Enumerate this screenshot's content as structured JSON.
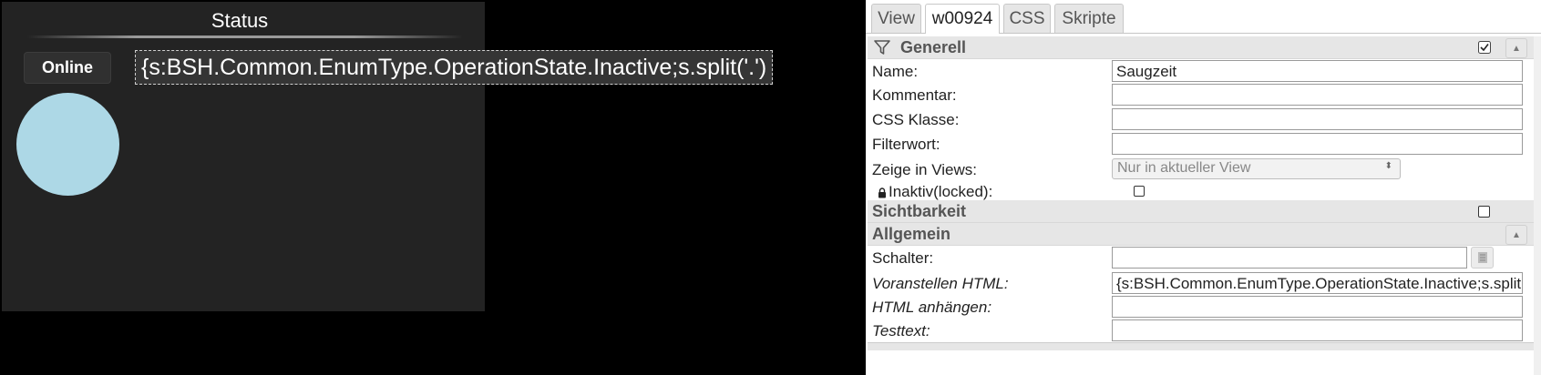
{
  "canvas": {
    "widget_title": "Status",
    "online_button_label": "Online",
    "html_prefix_display": "{s:BSH.Common.EnumType.OperationState.Inactive;s.split('.')",
    "circle_color": "#add8e6"
  },
  "tabs": [
    {
      "label": "View"
    },
    {
      "label": "w00924",
      "active": true
    },
    {
      "label": "CSS"
    },
    {
      "label": "Skripte"
    }
  ],
  "sections": {
    "generell": "Generell",
    "sichtbarkeit": "Sichtbarkeit",
    "allgemein": "Allgemein"
  },
  "generell": {
    "name_label": "Name:",
    "name_value": "Saugzeit",
    "kommentar_label": "Kommentar:",
    "kommentar_value": "",
    "css_klasse_label": "CSS Klasse:",
    "css_klasse_value": "",
    "filterwort_label": "Filterwort:",
    "filterwort_value": "",
    "zeige_label": "Zeige in Views:",
    "zeige_value": "Nur in aktueller View",
    "inaktiv_label": "Inaktiv(locked):"
  },
  "allgemein": {
    "schalter_label": "Schalter:",
    "schalter_value": "",
    "voranstellen_label": "Voranstellen HTML:",
    "voranstellen_value": "{s:BSH.Common.EnumType.OperationState.Inactive;s.split('.')",
    "anhaengen_label": "HTML anhängen:",
    "anhaengen_value": "",
    "testtext_label": "Testtext:",
    "testtext_value": ""
  },
  "icons": [
    "filter-icon",
    "lock-icon",
    "collapse-up-icon",
    "checkbox-icon",
    "list-select-icon",
    "select-arrow-icon"
  ]
}
